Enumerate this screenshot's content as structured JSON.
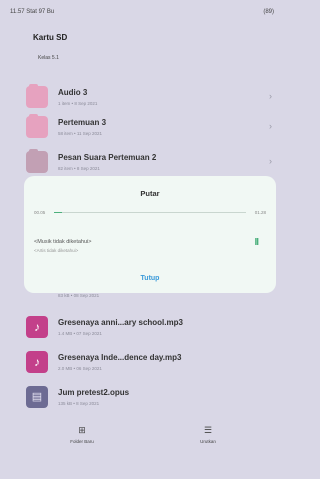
{
  "status": {
    "left": "11.57  Stat 97 Bu",
    "right": "(89)"
  },
  "header": {
    "title": "Kartu SD",
    "subtitle": "Kelas 5.1"
  },
  "files": [
    {
      "name": "Audio 3",
      "meta": "1 item • 8 Sep 2021",
      "icon": "folder-icon"
    },
    {
      "name": "Pertemuan 3",
      "meta": "58 item • 11 Sep 2021",
      "icon": "folder-icon"
    },
    {
      "name": "Pesan Suara Pertemuan 2",
      "meta": "82 item • 8 Sep 2021",
      "icon": "folder-icon"
    },
    {
      "name": "Gresenaya anni...ary school.mp3",
      "meta": "1.4 MB • 07 Sep 2021",
      "icon": "music-icon"
    },
    {
      "name": "Gresenaya Inde...dence day.mp3",
      "meta": "2.0 MB • 06 Sep 2021",
      "icon": "music-icon"
    },
    {
      "name": "Jum pretest2.opus",
      "meta": "135 kB • 8 Sep 2021",
      "icon": "doc-icon"
    }
  ],
  "hidden_row_meta": "83 kB • 08 Sep 2021",
  "player": {
    "title": "Putar",
    "time_elapsed": "00.05",
    "time_total": "01.28",
    "progress": 0.04,
    "track_title": "<Musik tidak diketahui>",
    "track_artist": "<Artis tidak diketahui>",
    "pause_label": "II",
    "close_label": "Tutup"
  },
  "nav": {
    "left_label": "Folder Baru",
    "right_label": "Urutkan"
  },
  "colors": {
    "accent": "#4cb07c",
    "link": "#3a9ad9",
    "background": "#d9d7e6",
    "dialog": "#f1f8f4"
  }
}
